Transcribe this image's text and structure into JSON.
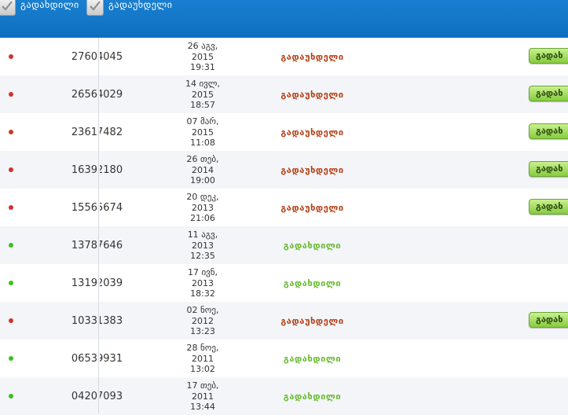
{
  "filters": {
    "paid_label": "გადახდილი",
    "unpaid_label": "გადაუხდელი"
  },
  "colors": {
    "header_bg": "#1177c8",
    "unpaid_text": "#b33c12",
    "paid_text": "#66b92c",
    "dot_red": "#d0332a",
    "dot_green": "#3ebd22"
  },
  "rows": [
    {
      "status_dot": "red",
      "id": "2760",
      "ref": "4045",
      "date": "26 აგვ,",
      "year": "2015",
      "time": "19:31",
      "status": "გადაუხდელი",
      "paid": false,
      "button": "გადახ"
    },
    {
      "status_dot": "red",
      "id": "2656",
      "ref": "4029",
      "date": "14 ივლ,",
      "year": "2015",
      "time": "18:57",
      "status": "გადაუხდელი",
      "paid": false,
      "button": "გადახ"
    },
    {
      "status_dot": "red",
      "id": "2361",
      "ref": "7482",
      "date": "07 მარ,",
      "year": "2015",
      "time": "11:08",
      "status": "გადაუხდელი",
      "paid": false,
      "button": "გადახ"
    },
    {
      "status_dot": "red",
      "id": "1639",
      "ref": "2180",
      "date": "26 თებ,",
      "year": "2014",
      "time": "19:00",
      "status": "გადაუხდელი",
      "paid": false,
      "button": "გადახ"
    },
    {
      "status_dot": "red",
      "id": "1556",
      "ref": "5674",
      "date": "20 დეკ,",
      "year": "2013",
      "time": "21:06",
      "status": "გადაუხდელი",
      "paid": false,
      "button": "გადახ"
    },
    {
      "status_dot": "green",
      "id": "1378",
      "ref": "7646",
      "date": "11 აგვ,",
      "year": "2013",
      "time": "12:35",
      "status": "გადახდილი",
      "paid": true,
      "button": ""
    },
    {
      "status_dot": "green",
      "id": "1319",
      "ref": "2039",
      "date": "17 ივნ,",
      "year": "2013",
      "time": "18:32",
      "status": "გადახდილი",
      "paid": true,
      "button": ""
    },
    {
      "status_dot": "red",
      "id": "1033",
      "ref": "1383",
      "date": "02 ნოე,",
      "year": "2012",
      "time": "13:23",
      "status": "გადაუხდელი",
      "paid": false,
      "button": "გადახ"
    },
    {
      "status_dot": "green",
      "id": "0653",
      "ref": "9931",
      "date": "28 ნოე,",
      "year": "2011",
      "time": "13:02",
      "status": "გადახდილი",
      "paid": true,
      "button": ""
    },
    {
      "status_dot": "green",
      "id": "0420",
      "ref": "7093",
      "date": "17 თებ,",
      "year": "2011",
      "time": "13:44",
      "status": "გადახდილი",
      "paid": true,
      "button": ""
    }
  ]
}
